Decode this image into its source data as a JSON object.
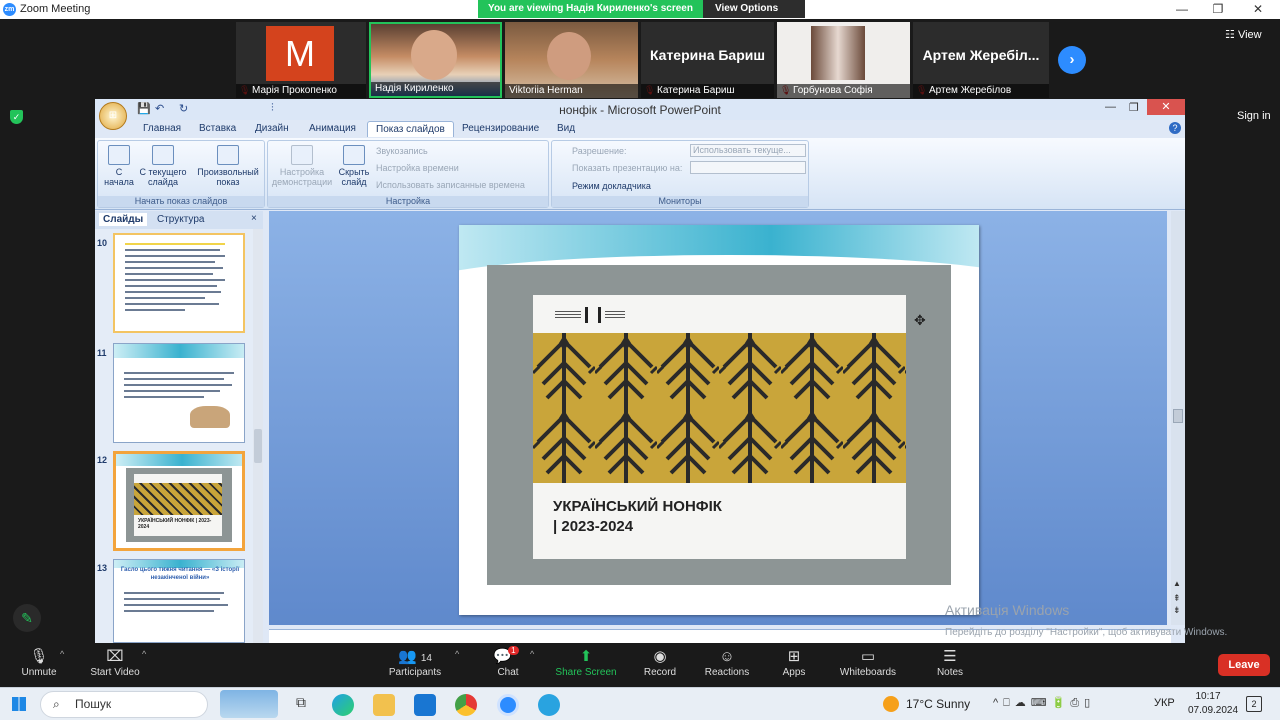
{
  "window": {
    "title": "Zoom Meeting",
    "logo_text": "zm",
    "minimize": "—",
    "maximize": "❐",
    "close": "✕"
  },
  "banner": {
    "message": "You are viewing Надія Кириленко's screen",
    "options": "View Options",
    "options_caret": "⌄"
  },
  "gallery": {
    "view_label": "Views",
    "view_text": "View",
    "next_arrow": "›",
    "tiles": [
      {
        "name": "Марія Прокопенко",
        "avatar_letter": "M",
        "avatar_color": "#d4431d",
        "muted": true
      },
      {
        "name": "Надія Кириленко",
        "video": true,
        "muted": false
      },
      {
        "name": "Viktoriia Herman",
        "video": true,
        "muted": false
      },
      {
        "name": "Катерина Бариш",
        "big_name": "Катерина Бариш",
        "muted": true
      },
      {
        "name": "Горбунова Софія",
        "video": true,
        "muted": true
      },
      {
        "name": "Артем Жеребілов",
        "big_name": "Артем  Жеребіл...",
        "muted": true
      }
    ]
  },
  "signin": "Sign in",
  "powerpoint": {
    "title": "нонфік - Microsoft PowerPoint",
    "office_button": "⊞",
    "qat": {
      "save": "💾",
      "undo": "↶",
      "redo": "↻",
      "separator": "⫶"
    },
    "help": "?",
    "tabs": [
      "Главная",
      "Вставка",
      "Дизайн",
      "Анимация",
      "Показ слайдов",
      "Рецензирование",
      "Вид"
    ],
    "active_tab": "Показ слайдов",
    "ribbon": {
      "group1": {
        "label": "Начать показ слайдов",
        "buttons": [
          "С начала",
          "С текущего слайда",
          "Произвольный показ"
        ]
      },
      "group2": {
        "label": "Настройка",
        "buttons": [
          "Настройка демонстрации",
          "Скрыть слайд"
        ],
        "lines": [
          "Звукозапись",
          "Настройка времени",
          "Использовать записанные времена"
        ]
      },
      "group3": {
        "label": "Мониторы",
        "resolution_label": "Разрешение:",
        "resolution_value": "Использовать текуще...",
        "show_on_label": "Показать презентацию на:",
        "presenter_mode": "Режим докладчика"
      }
    },
    "pane_tabs": [
      "Слайды",
      "Структура"
    ],
    "pane_close": "×",
    "thumbnails": [
      {
        "number": "10"
      },
      {
        "number": "11"
      },
      {
        "number": "12",
        "caption": "УКРАЇНСЬКИЙ НОНФІК | 2023-2024"
      },
      {
        "number": "13",
        "caption": "Гасло цього тижня читання — «З історії незакінченої війни»"
      }
    ],
    "slide": {
      "title_line1": "УКРАЇНСЬКИЙ НОНФІК",
      "title_line2": "| 2023-2024"
    }
  },
  "activation": {
    "title": "Активація Windows",
    "text": "Перейдіть до розділу \"Настройки\", щоб активувати Windows."
  },
  "toolbar": {
    "unmute": "Unmute",
    "start_video": "Start Video",
    "participants": "Participants",
    "participants_count": "14",
    "chat": "Chat",
    "chat_badge": "1",
    "share_screen": "Share Screen",
    "record": "Record",
    "reactions": "Reactions",
    "apps": "Apps",
    "whiteboards": "Whiteboards",
    "notes": "Notes",
    "leave": "Leave"
  },
  "taskbar": {
    "search": "Пошук",
    "weather": "17°C  Sunny",
    "language": "УКР",
    "time": "10:17",
    "date": "07.09.2024",
    "notifications": "2"
  }
}
